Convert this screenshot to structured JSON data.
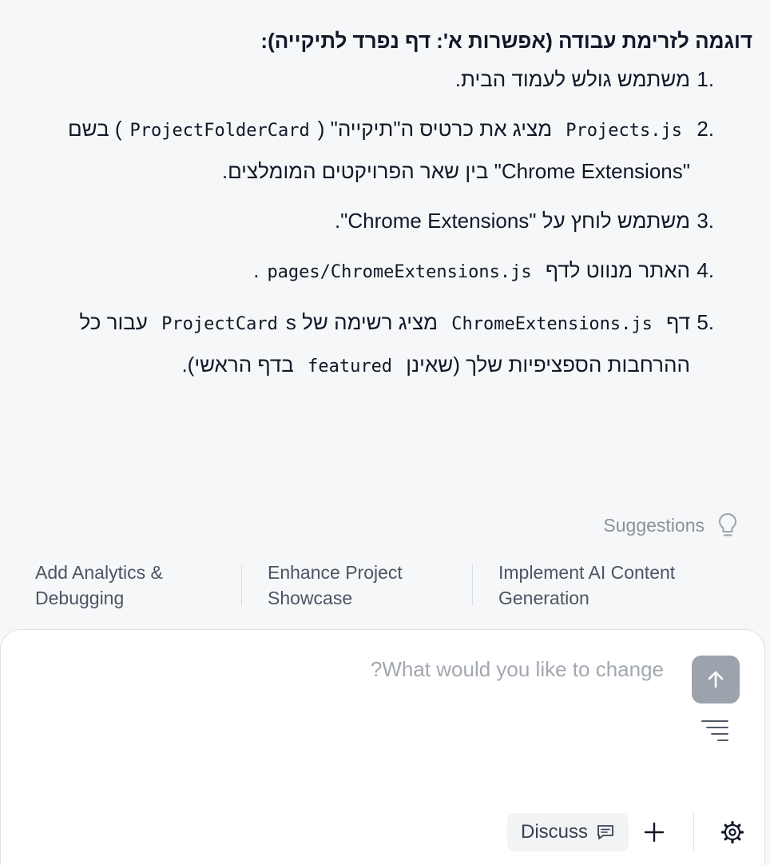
{
  "message": {
    "heading": "דוגמה לזרימת עבודה (אפשרות א': דף נפרד לתיקייה):",
    "steps": [
      {
        "num": "1.",
        "text": "משתמש גולש לעמוד הבית."
      },
      {
        "num": "2.",
        "code1": "Projects.js",
        "text1": "מציג את כרטיס ה\"תיקייה\"",
        "code2": "ProjectFolderCard",
        "text2": "בשם \"Chrome Extensions\" בין שאר הפרויקטים המומלצים."
      },
      {
        "num": "3.",
        "text": "משתמש לוחץ על \"Chrome Extensions\"."
      },
      {
        "num": "4.",
        "text": "האתר מנווט לדף",
        "code": "pages/ChromeExtensions.js",
        "tail": "."
      },
      {
        "num": "5.",
        "text1": "דף",
        "code1": "ChromeExtensions.js",
        "text2": "מציג רשימה של",
        "code2": "ProjectCard",
        "text3": "s עבור כל ההרחבות הספציפיות שלך (שאינן",
        "code3": "featured",
        "text4": "בדף הראשי)."
      }
    ]
  },
  "suggestions": {
    "label": "Suggestions",
    "icon": "lightbulb-icon",
    "items": [
      "Add Analytics & Debugging",
      "Enhance Project Showcase",
      "Implement AI Content Generation"
    ]
  },
  "composer": {
    "placeholder": "What would you like to change?",
    "discuss_label": "Discuss"
  },
  "colors": {
    "page_background": "#f6f7f9",
    "send_button": "#9ca3ad",
    "muted_text": "#8b919b"
  }
}
